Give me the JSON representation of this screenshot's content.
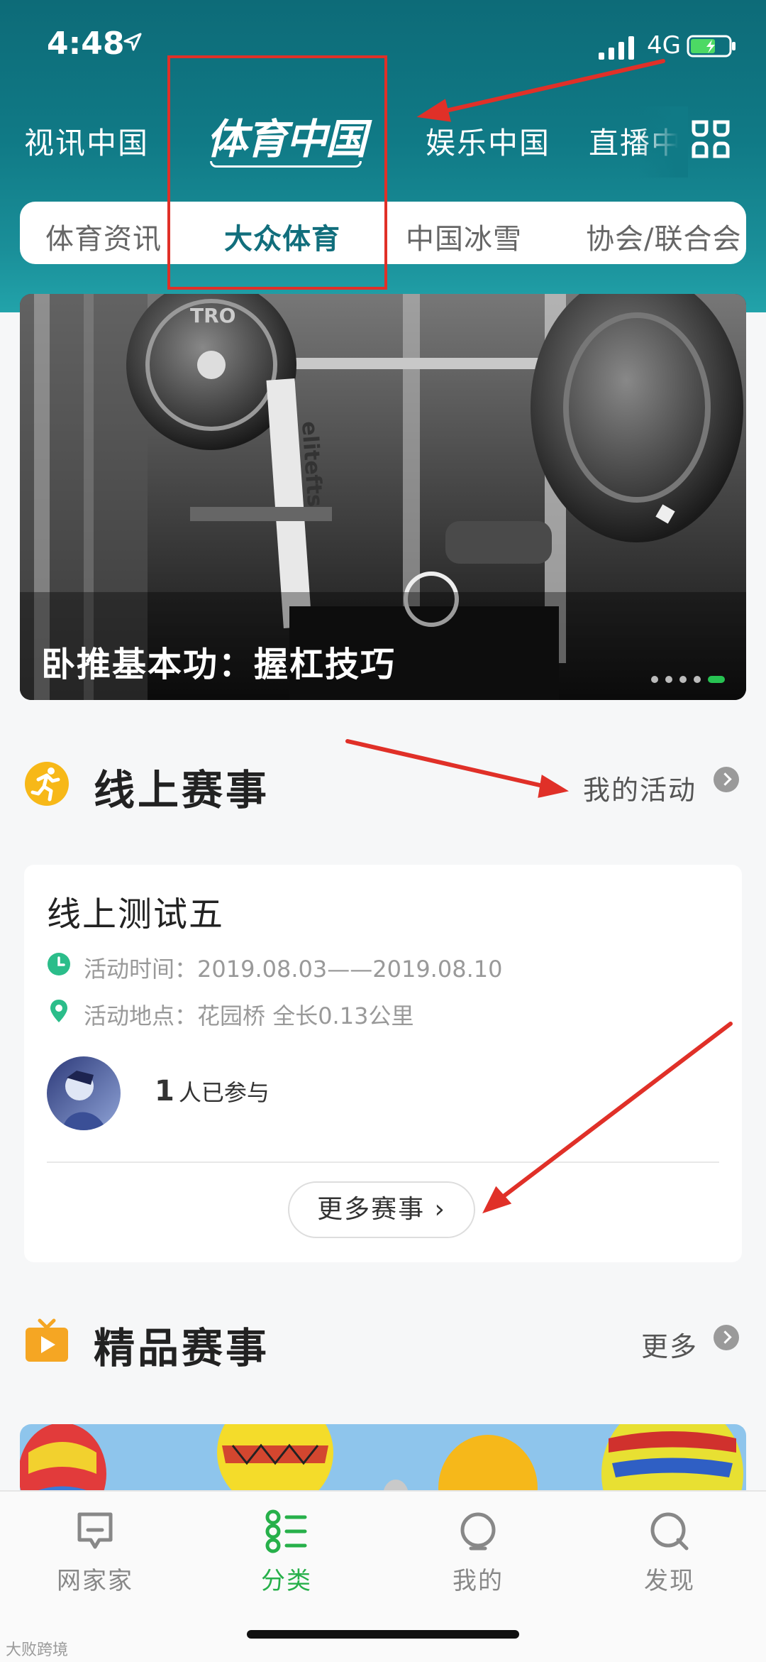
{
  "status": {
    "time": "4:48",
    "network": "4G"
  },
  "top_nav": {
    "items": [
      "视讯中国",
      "娱乐中国",
      "直播中"
    ],
    "brand": "体育中国"
  },
  "sub_tabs": [
    "体育资讯",
    "大众体育",
    "中国冰雪",
    "协会/联合会"
  ],
  "banner": {
    "caption": "卧推基本功：握杠技巧",
    "slide_count": 5,
    "active_slide": 5
  },
  "online_events": {
    "title": "线上赛事",
    "link": "我的活动",
    "card": {
      "title": "线上测试五",
      "time_label": "活动时间：",
      "time_value": "2019.08.03——2019.08.10",
      "location_label": "活动地点：",
      "location_value": "花园桥  全长0.13公里",
      "participants_count": "1",
      "participants_text": "人已参与",
      "more_button": "更多赛事"
    }
  },
  "featured_events": {
    "title": "精品赛事",
    "link": "更多"
  },
  "tab_bar": [
    {
      "label": "网家家",
      "icon": "chat-icon",
      "active": false
    },
    {
      "label": "分类",
      "icon": "category-icon",
      "active": true
    },
    {
      "label": "我的",
      "icon": "profile-icon",
      "active": false
    },
    {
      "label": "发现",
      "icon": "discover-icon",
      "active": false
    }
  ],
  "watermark": "大败跨境",
  "colors": {
    "header": "#107a86",
    "accent_green": "#27b04a",
    "annotation_red": "#e03028",
    "active_subtab": "#116e7c"
  }
}
